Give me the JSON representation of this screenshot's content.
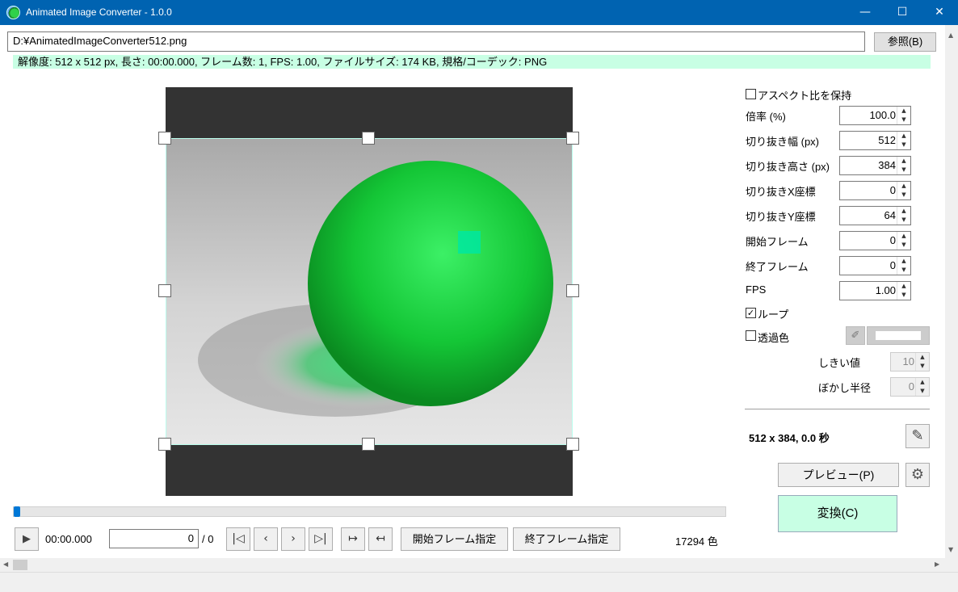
{
  "window": {
    "title": "Animated Image Converter - 1.0.0",
    "minimize": "—",
    "maximize": "☐",
    "close": "✕"
  },
  "file": {
    "path": "D:¥AnimatedImageConverter512.png",
    "browse_label": "参照(B)"
  },
  "info": {
    "text": "解像度: 512 x 512 px, 長さ: 00:00.000, フレーム数: 1, FPS: 1.00, ファイルサイズ: 174 KB, 規格/コーデック: PNG"
  },
  "settings": {
    "keep_aspect": {
      "label": "アスペクト比を保持",
      "checked": false
    },
    "scale": {
      "label": "倍率 (%)",
      "value": "100.0"
    },
    "crop_width": {
      "label": "切り抜き幅 (px)",
      "value": "512"
    },
    "crop_height": {
      "label": "切り抜き高さ (px)",
      "value": "384"
    },
    "crop_x": {
      "label": "切り抜きX座標",
      "value": "0"
    },
    "crop_y": {
      "label": "切り抜きY座標",
      "value": "64"
    },
    "start_frame": {
      "label": "開始フレーム",
      "value": "0"
    },
    "end_frame": {
      "label": "終了フレーム",
      "value": "0"
    },
    "fps": {
      "label": "FPS",
      "value": "1.00"
    },
    "loop": {
      "label": "ループ",
      "checked": true
    },
    "transparent": {
      "label": "透過色",
      "checked": false
    },
    "threshold": {
      "label": "しきい値",
      "value": "10"
    },
    "blur": {
      "label": "ぼかし半径",
      "value": "0"
    }
  },
  "output": {
    "summary": "512 x 384, 0.0 秒",
    "preview_label": "プレビュー(P)",
    "convert_label": "変換(C)"
  },
  "player": {
    "time": "00:00.000",
    "frame_value": "0",
    "frame_total": "/ 0",
    "progress": 0,
    "set_start_label": "開始フレーム指定",
    "set_end_label": "終了フレーム指定",
    "colors": "17294 色"
  },
  "icons": {
    "play": "▶",
    "first": "|◁",
    "prev": "‹",
    "next": "›",
    "last": "▷|",
    "pencil": "✎",
    "gear": "⚙",
    "eyedropper": "✐"
  },
  "palette": {
    "titlebar": "#0063b1",
    "info_bg": "#c8ffe4",
    "convert_bg": "#c8ffe4",
    "sphere": "#16c43a"
  }
}
